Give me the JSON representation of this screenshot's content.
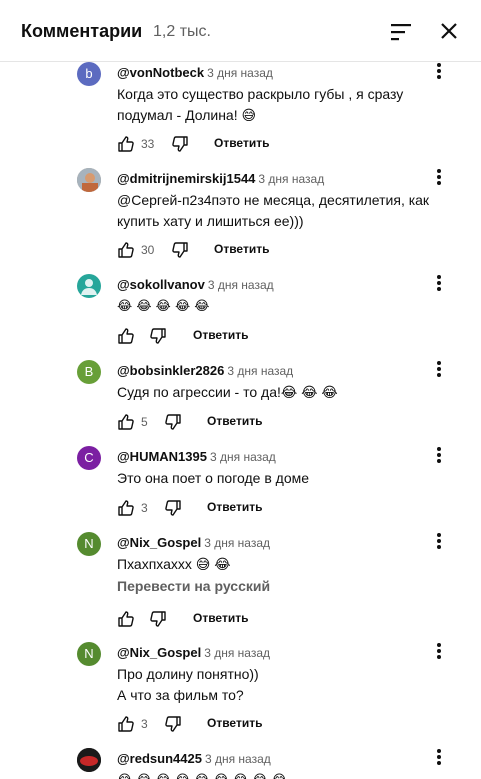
{
  "header": {
    "title": "Комментарии",
    "count": "1,2 тыс."
  },
  "comments": [
    {
      "author": "@vonNotbeck",
      "date": "3 дня назад",
      "avatar_letter": "b",
      "avatar_color": "#5c6bc0",
      "lines": [
        "Когда это существо раскрыло губы , я сразу",
        "подумал - Долина! 😅"
      ],
      "likes": "33",
      "reply": "Ответить"
    },
    {
      "author": "@dmitrijnemirskij1544",
      "date": "3 дня назад",
      "avatar_letter": "",
      "avatar_color": "#8a8a8a",
      "lines": [
        "@Сергей-п2з4пэто не месяца, десятилетия, как",
        "купить хату и лишиться ее)))"
      ],
      "likes": "30",
      "reply": "Ответить"
    },
    {
      "author": "@sokollvanov",
      "date": "3 дня назад",
      "avatar_letter": "",
      "avatar_color": "#26a69a",
      "lines": [
        "😂 😂 😂 😂 😂"
      ],
      "likes": "",
      "reply": "Ответить"
    },
    {
      "author": "@bobsinkler2826",
      "date": "3 дня назад",
      "avatar_letter": "B",
      "avatar_color": "#689f38",
      "lines": [
        "Судя по агрессии - то да!😂 😂 😂"
      ],
      "likes": "5",
      "reply": "Ответить"
    },
    {
      "author": "@HUMAN1395",
      "date": "3 дня назад",
      "avatar_letter": "C",
      "avatar_color": "#7b1fa2",
      "lines": [
        "Это она поет о погоде в доме"
      ],
      "likes": "3",
      "reply": "Ответить"
    },
    {
      "author": "@Nix_Gospel",
      "date": "3 дня назад",
      "avatar_letter": "N",
      "avatar_color": "#558b2f",
      "lines": [
        "Пхахпхаххх 😅 😂"
      ],
      "translate": "Перевести на русский",
      "likes": "",
      "reply": "Ответить"
    },
    {
      "author": "@Nix_Gospel",
      "date": "3 дня назад",
      "avatar_letter": "N",
      "avatar_color": "#558b2f",
      "lines": [
        "Про долину понятно))",
        "А что за фильм то?"
      ],
      "likes": "3",
      "reply": "Ответить"
    },
    {
      "author": "@redsun4425",
      "date": "3 дня назад",
      "avatar_letter": "",
      "avatar_color": "#b71c1c",
      "lines": [
        "😂 😂 😂 😂 😂 😂 😂 😂 😂"
      ]
    }
  ]
}
